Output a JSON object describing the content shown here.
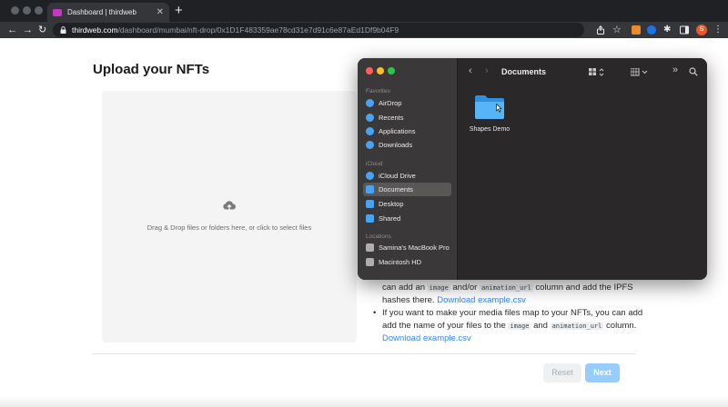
{
  "browser": {
    "tab_title": "Dashboard | thirdweb",
    "url_host": "thirdweb.com",
    "url_path": "/dashboard/mumbai/nft-drop/0x1D1F483359ae78cd31e7d91c6e87aEd1Df9b04F9",
    "profile_initial": "S",
    "icons": [
      "back-arrow-icon",
      "forward-arrow-icon",
      "reload-icon",
      "lock-icon",
      "share-icon",
      "star-icon",
      "puzzle-icon",
      "sidebar-icon"
    ]
  },
  "page": {
    "title": "Upload your NFTs",
    "dropzone_text": "Drag & Drop files or folders here, or click to select files",
    "instructions": {
      "line1_prefix": "can add an ",
      "line1_code1": "image",
      "line1_mid": " and/or ",
      "line1_code2": "animation_url",
      "line1_suffix": " column and add the IPFS hashes there. ",
      "line1_link": "Download example.csv",
      "bullet": "•",
      "line2_prefix": "If you want to make your media files map to your NFTs, you can add add the name of your files to the ",
      "line2_code1": "image",
      "line2_mid": " and ",
      "line2_code2": "animation_url",
      "line2_suffix": " column. ",
      "line2_link": "Download example.csv"
    },
    "reset_label": "Reset",
    "next_label": "Next",
    "colors": {
      "link": "#3385ff",
      "next_button": "#97ccff"
    }
  },
  "finder": {
    "current_folder": "Documents",
    "sections": {
      "favorites": "Favorites",
      "icloud": "iCloud",
      "locations": "Locations"
    },
    "favorites": [
      "AirDrop",
      "Recents",
      "Applications",
      "Downloads"
    ],
    "icloud_items": [
      "iCloud Drive",
      "Documents",
      "Desktop",
      "Shared"
    ],
    "locations": [
      "Samina's MacBook Pro",
      "Macintosh HD"
    ],
    "selected_item": "Documents",
    "files": [
      {
        "name": "Shapes Demo",
        "kind": "folder"
      }
    ]
  }
}
